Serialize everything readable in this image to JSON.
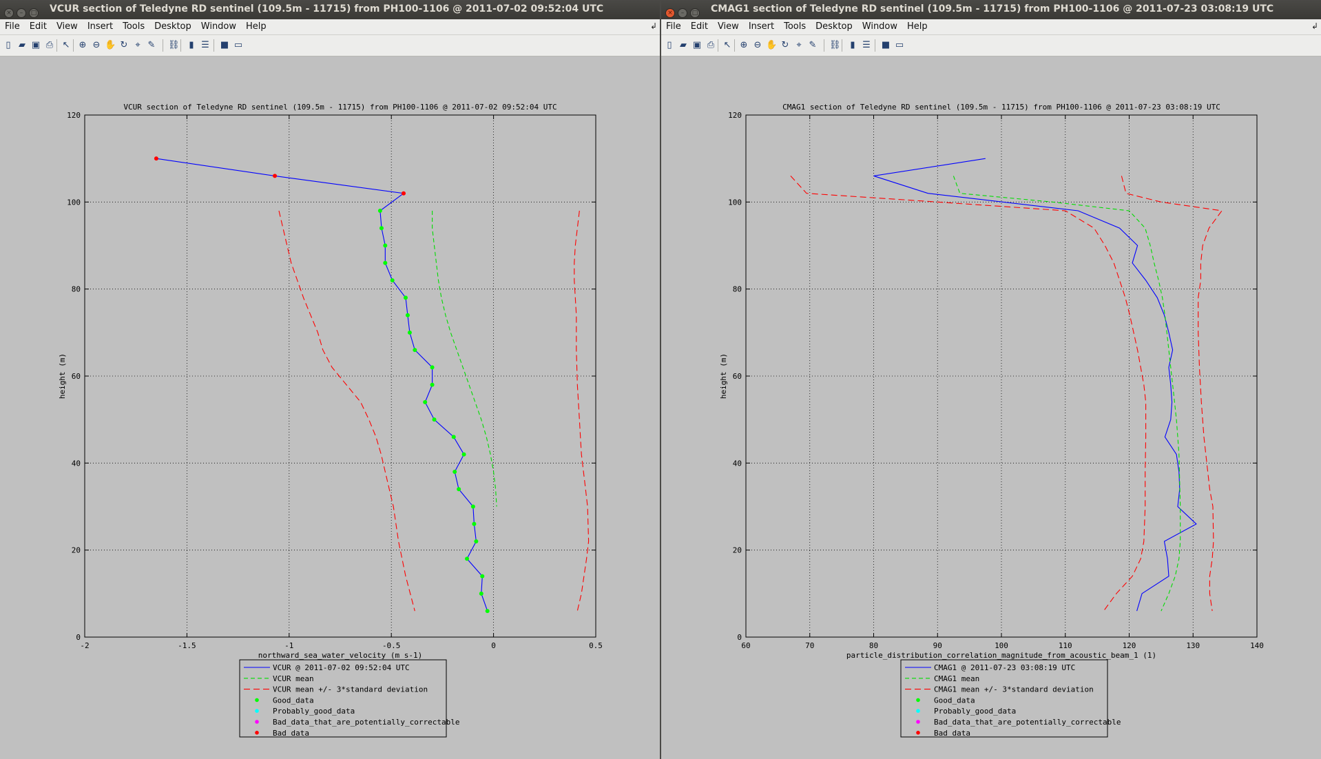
{
  "windows": [
    {
      "title": "VCUR section of Teledyne RD sentinel (109.5m - 11715) from PH100-1106 @ 2011-07-02 09:52:04 UTC",
      "menu": [
        "File",
        "Edit",
        "View",
        "Insert",
        "Tools",
        "Desktop",
        "Window",
        "Help"
      ]
    },
    {
      "title": "CMAG1 section of Teledyne RD sentinel (109.5m - 11715) from PH100-1106 @ 2011-07-23 03:08:19 UTC",
      "menu": [
        "File",
        "Edit",
        "View",
        "Insert",
        "Tools",
        "Desktop",
        "Window",
        "Help"
      ]
    }
  ],
  "toolbar_icons": [
    "new-icon",
    "open-icon",
    "save-icon",
    "print-icon",
    "pointer-icon",
    "zoom-in-icon",
    "zoom-out-icon",
    "pan-icon",
    "rotate-icon",
    "data-cursor-icon",
    "brush-icon",
    "link-icon",
    "colorbar-icon",
    "legend-icon",
    "hide-tools-icon",
    "show-tools-icon"
  ],
  "colors": {
    "series": "#0000ff",
    "mean": "#00dd00",
    "std": "#ff0000",
    "good": "#00ff00",
    "probably_good": "#00ffff",
    "bad_correctable": "#ff00ff",
    "bad": "#ff0000",
    "axes_bg": "#c0c0c0"
  },
  "chart_data": [
    {
      "type": "line",
      "title": "VCUR section of Teledyne RD sentinel (109.5m - 11715) from PH100-1106 @ 2011-07-02 09:52:04 UTC",
      "xlabel": "northward_sea_water_velocity (m s-1)",
      "ylabel": "height (m)",
      "xlim": [
        -2,
        0.5
      ],
      "ylim": [
        0,
        120
      ],
      "xticks": [
        "-2",
        "-1.5",
        "-1",
        "-0.5",
        "0",
        "0.5"
      ],
      "yticks": [
        "0",
        "20",
        "40",
        "60",
        "80",
        "100",
        "120"
      ],
      "grid": true,
      "series": [
        {
          "name": "VCUR @ 2011-07-02 09:52:04 UTC",
          "x": [
            -1.65,
            -1.07,
            -0.44,
            -0.555,
            -0.548,
            -0.53,
            -0.53,
            -0.495,
            -0.43,
            -0.42,
            -0.41,
            -0.385,
            -0.3,
            -0.3,
            -0.335,
            -0.29,
            -0.195,
            -0.145,
            -0.19,
            -0.17,
            -0.1,
            -0.095,
            -0.085,
            -0.13,
            -0.055,
            -0.06,
            -0.03
          ],
          "y": [
            110,
            106,
            102,
            98,
            94,
            90,
            86,
            82,
            78,
            74,
            70,
            66,
            62,
            58,
            54,
            50,
            46,
            42,
            38,
            34,
            30,
            26,
            22,
            18,
            14,
            10,
            6
          ]
        },
        {
          "name": "VCUR mean",
          "x": [
            -0.3,
            -0.3,
            -0.29,
            -0.28,
            -0.27,
            -0.255,
            -0.235,
            -0.21,
            -0.18,
            -0.15,
            -0.12,
            -0.09,
            -0.06,
            -0.035,
            -0.015,
            0.0,
            0.01,
            0.015
          ],
          "y": [
            98,
            94,
            90,
            86,
            82,
            78,
            74,
            70,
            66,
            62,
            58,
            54,
            50,
            46,
            42,
            38,
            34,
            30
          ]
        },
        {
          "name": "VCUR mean +/- 3*standard deviation",
          "x": [
            -1.05,
            -1.03,
            -1.01,
            -0.99,
            -0.96,
            -0.93,
            -0.895,
            -0.86,
            -0.835,
            -0.79,
            -0.72,
            -0.65,
            -0.61,
            -0.575,
            -0.55,
            -0.53,
            -0.51,
            -0.49,
            -0.465,
            -0.43,
            -0.385
          ],
          "y": [
            98,
            94,
            90,
            86,
            82,
            78,
            74,
            70,
            66,
            62,
            58,
            54,
            50,
            46,
            42,
            38,
            34,
            30,
            22,
            14,
            6
          ]
        },
        {
          "name": "",
          "x": [
            0.42,
            0.41,
            0.4,
            0.395,
            0.395,
            0.4,
            0.405,
            0.405,
            0.41,
            0.42,
            0.425,
            0.43,
            0.44,
            0.45,
            0.46,
            0.465,
            0.455,
            0.43,
            0.41
          ],
          "y": [
            98,
            94,
            90,
            86,
            82,
            78,
            74,
            66,
            58,
            50,
            46,
            42,
            38,
            34,
            30,
            22,
            18,
            10,
            6
          ]
        }
      ],
      "points": {
        "good": {
          "x": [
            -0.555,
            -0.548,
            -0.53,
            -0.53,
            -0.495,
            -0.43,
            -0.42,
            -0.41,
            -0.385,
            -0.3,
            -0.3,
            -0.335,
            -0.29,
            -0.195,
            -0.145,
            -0.19,
            -0.17,
            -0.1,
            -0.095,
            -0.085,
            -0.13,
            -0.055,
            -0.06,
            -0.03
          ],
          "y": [
            98,
            94,
            90,
            86,
            82,
            78,
            74,
            70,
            66,
            62,
            58,
            54,
            50,
            46,
            42,
            38,
            34,
            30,
            26,
            22,
            18,
            14,
            10,
            6
          ]
        },
        "bad": {
          "x": [
            -1.65,
            -1.07,
            -0.44
          ],
          "y": [
            110,
            106,
            102
          ]
        }
      },
      "legend": [
        "VCUR @ 2011-07-02 09:52:04 UTC",
        "VCUR mean",
        "VCUR mean +/- 3*standard deviation",
        "Good_data",
        "Probably_good_data",
        "Bad_data_that_are_potentially_correctable",
        "Bad_data"
      ],
      "legend_position": "bottom-outside"
    },
    {
      "type": "line",
      "title": "CMAG1 section of Teledyne RD sentinel (109.5m - 11715) from PH100-1106 @ 2011-07-23 03:08:19 UTC",
      "xlabel": "particle_distribution_correlation_magnitude_from_acoustic_beam_1 (1)",
      "ylabel": "height (m)",
      "xlim": [
        60,
        140
      ],
      "ylim": [
        0,
        120
      ],
      "xticks": [
        "60",
        "70",
        "80",
        "90",
        "100",
        "110",
        "120",
        "130",
        "140"
      ],
      "yticks": [
        "0",
        "20",
        "40",
        "60",
        "80",
        "100",
        "120"
      ],
      "grid": true,
      "series": [
        {
          "name": "CMAG1 @ 2011-07-23 03:08:19 UTC",
          "x": [
            97.5,
            80,
            88.5,
            112,
            118.5,
            121.3,
            120.5,
            122.6,
            124.4,
            125.5,
            126.2,
            126.8,
            126.2,
            126.5,
            126.7,
            126.5,
            125.6,
            127.4,
            127.8,
            127.9,
            127.6,
            130.5,
            125.5,
            126,
            126.2,
            122,
            121.2
          ],
          "y": [
            110,
            106,
            102,
            98,
            94,
            90,
            86,
            82,
            78,
            74,
            70,
            66,
            62,
            58,
            54,
            50,
            46,
            42,
            38,
            34,
            30,
            26,
            22,
            18,
            14,
            10,
            6
          ]
        },
        {
          "name": "CMAG1 mean",
          "x": [
            92.5,
            93.5,
            108,
            120,
            122.5,
            123.3,
            123.9,
            124.6,
            125.2,
            125.6,
            125.9,
            126.2,
            126.5,
            126.8,
            127.1,
            127.4,
            127.6,
            127.8,
            128,
            128,
            127.8,
            127.2,
            126.2,
            125
          ],
          "y": [
            106,
            102,
            100,
            98,
            94,
            90,
            86,
            82,
            78,
            74,
            70,
            66,
            62,
            58,
            54,
            50,
            46,
            42,
            30,
            22,
            18,
            14,
            10,
            6
          ]
        },
        {
          "name": "CMAG1 mean +/- 3*standard deviation",
          "x": [
            67,
            69.5,
            90,
            110,
            114.5,
            116.2,
            117.6,
            118.5,
            119.4,
            120.1,
            120.7,
            121.3,
            121.8,
            122.3,
            122.6,
            122.6,
            122.5,
            122.5,
            122.3,
            121.8,
            120.5,
            118,
            116
          ],
          "y": [
            106,
            102,
            100,
            98,
            94,
            90,
            86,
            82,
            78,
            74,
            70,
            66,
            62,
            58,
            54,
            46,
            38,
            30,
            22,
            18,
            14,
            10,
            6
          ]
        },
        {
          "name": "",
          "x": [
            118.8,
            119.5,
            125,
            134.5,
            132.5,
            131.5,
            131.2,
            131.2,
            130.8,
            130.8,
            131,
            131.3,
            131.7,
            132.3,
            132.6,
            133.1,
            133.2,
            133,
            132.6,
            132.6,
            133
          ],
          "y": [
            106,
            102,
            100,
            98,
            94,
            90,
            86,
            82,
            78,
            70,
            62,
            54,
            46,
            38,
            34,
            30,
            22,
            18,
            14,
            10,
            6
          ]
        }
      ],
      "legend": [
        "CMAG1 @ 2011-07-23 03:08:19 UTC",
        "CMAG1 mean",
        "CMAG1 mean +/- 3*standard deviation",
        "Good_data",
        "Probably_good_data",
        "Bad_data_that_are_potentially_correctable",
        "Bad_data"
      ],
      "legend_position": "bottom-outside"
    }
  ]
}
